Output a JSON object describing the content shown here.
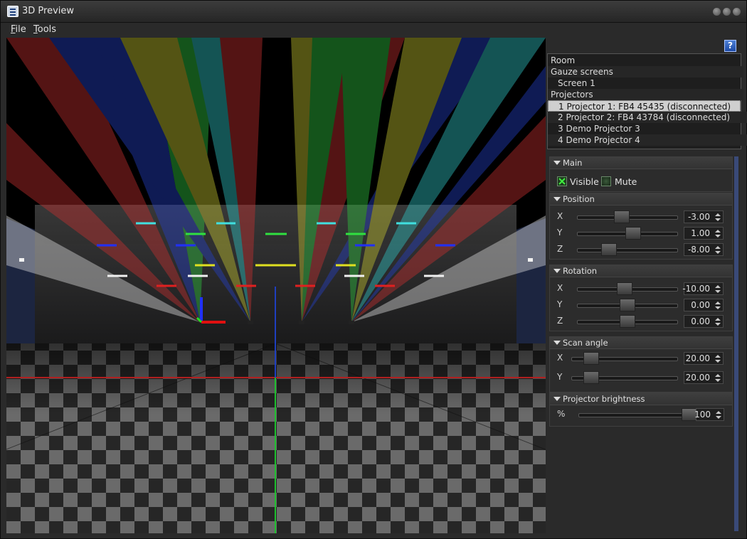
{
  "window": {
    "title": "3D Preview",
    "icon": "app-logo-icon"
  },
  "menu": {
    "file": "File",
    "file_ul": "F",
    "file_rest": "ile",
    "tools": "Tools",
    "tools_ul": "T",
    "tools_rest": "ools"
  },
  "help_label": "?",
  "tree": [
    {
      "label": "Room",
      "indent": 0
    },
    {
      "label": "Gauze screens",
      "indent": 0
    },
    {
      "label": "Screen 1",
      "indent": 1
    },
    {
      "label": "Projectors",
      "indent": 0
    },
    {
      "label": "1 Projector 1: FB4 45435 (disconnected)",
      "indent": 1,
      "selected": true
    },
    {
      "label": "2 Projector 2: FB4 43784 (disconnected)",
      "indent": 1
    },
    {
      "label": "3 Demo Projector 3",
      "indent": 1
    },
    {
      "label": "4 Demo Projector 4",
      "indent": 1
    }
  ],
  "sections": {
    "main": {
      "title": "Main",
      "visible_label": "Visible",
      "visible_checked": true,
      "mute_label": "Mute",
      "mute_checked": false
    },
    "position": {
      "title": "Position",
      "rows": [
        {
          "label": "X",
          "value": "-3.00",
          "level": 0.43
        },
        {
          "label": "Y",
          "value": "1.00",
          "level": 0.57
        },
        {
          "label": "Z",
          "value": "-8.00",
          "level": 0.28
        }
      ]
    },
    "rotation": {
      "title": "Rotation",
      "rows": [
        {
          "label": "X",
          "value": "-10.00",
          "level": 0.47
        },
        {
          "label": "Y",
          "value": "0.00",
          "level": 0.5
        },
        {
          "label": "Z",
          "value": "0.00",
          "level": 0.5
        }
      ]
    },
    "scan_angle": {
      "title": "Scan angle",
      "rows": [
        {
          "label": "X",
          "value": "20.00",
          "level": 0.13
        },
        {
          "label": "Y",
          "value": "20.00",
          "level": 0.13
        }
      ]
    },
    "brightness": {
      "title": "Projector brightness",
      "rows": [
        {
          "label": "%",
          "value": "100",
          "level": 1.0
        }
      ]
    }
  }
}
